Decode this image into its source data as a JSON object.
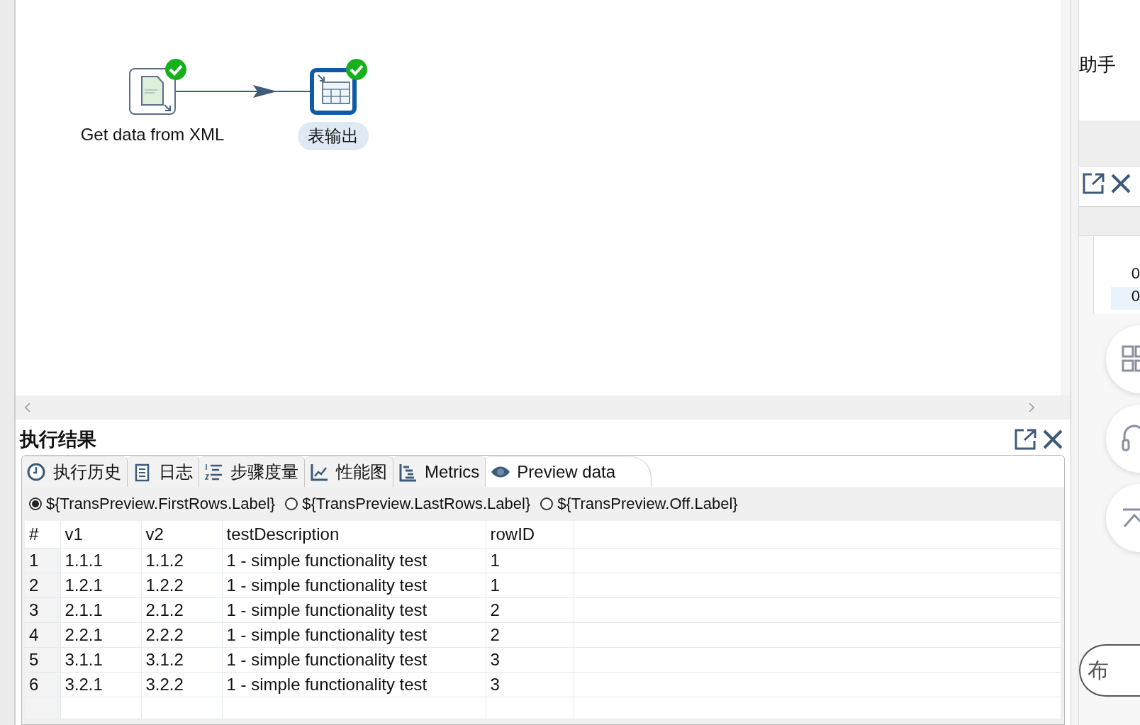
{
  "canvas": {
    "steps": [
      {
        "label": "Get data from XML",
        "kind": "xml-input",
        "selected": false,
        "finished": true
      },
      {
        "label": "表输出",
        "kind": "table-output",
        "selected": true,
        "finished": true
      }
    ]
  },
  "results": {
    "title": "执行结果",
    "tabs": [
      {
        "label": "执行历史",
        "selected": false
      },
      {
        "label": "日志",
        "selected": false
      },
      {
        "label": "步骤度量",
        "selected": false
      },
      {
        "label": "性能图",
        "selected": false
      },
      {
        "label": "Metrics",
        "selected": false
      },
      {
        "label": "Preview data",
        "selected": true
      }
    ],
    "preview_options": [
      {
        "label": "${TransPreview.FirstRows.Label}",
        "selected": true
      },
      {
        "label": "${TransPreview.LastRows.Label}",
        "selected": false
      },
      {
        "label": "${TransPreview.Off.Label}",
        "selected": false
      }
    ],
    "table": {
      "columns": [
        "#",
        "v1",
        "v2",
        "testDescription",
        "rowID"
      ],
      "rows": [
        [
          "1",
          "1.1.1",
          "1.1.2",
          "1 - simple functionality test",
          "1"
        ],
        [
          "2",
          "1.2.1",
          "1.2.2",
          "1 - simple functionality test",
          "1"
        ],
        [
          "3",
          "2.1.1",
          "2.1.2",
          "1 - simple functionality test",
          "2"
        ],
        [
          "4",
          "2.2.1",
          "2.2.2",
          "1 - simple functionality test",
          "2"
        ],
        [
          "5",
          "3.1.1",
          "3.1.2",
          "1 - simple functionality test",
          "3"
        ],
        [
          "6",
          "3.2.1",
          "3.2.2",
          "1 - simple functionality test",
          "3"
        ]
      ]
    }
  },
  "side_panel": {
    "title": "助手",
    "cells": [
      "0",
      "0"
    ],
    "button_label": "布"
  }
}
